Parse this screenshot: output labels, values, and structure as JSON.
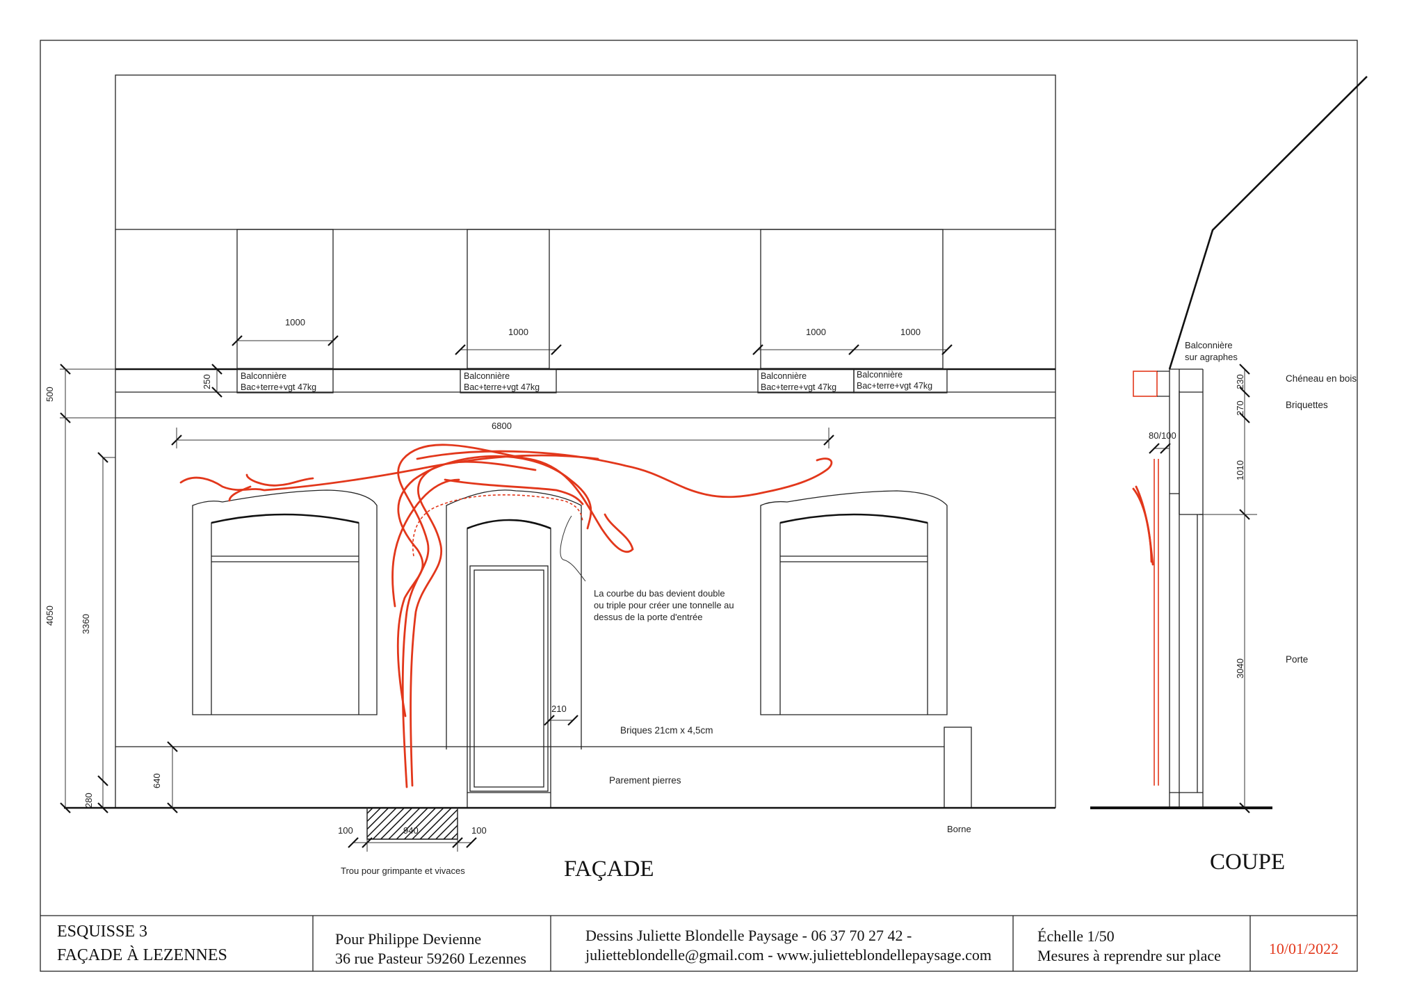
{
  "colors": {
    "line": "#222222",
    "plant": "#e2371b",
    "date": "#e2371b"
  },
  "facade": {
    "balcony_widths": [
      "1000",
      "1000",
      "1000",
      "1000"
    ],
    "balcony_label_line1": [
      "Balconnière",
      "Balconnière",
      "Balconnière",
      "Balconnière"
    ],
    "balcony_label_line2": [
      "Bac+terre+vgt 47kg",
      "Bac+terre+vgt 47kg",
      "Bac+terre+vgt 47kg",
      "Bac+terre+vgt 47kg"
    ],
    "dim_250": "250",
    "dim_500": "500",
    "dim_6800": "6800",
    "dim_4050": "4050",
    "dim_3360": "3360",
    "dim_640": "640",
    "dim_280": "280",
    "dim_210": "210",
    "dim_100_left": "100",
    "dim_940": "940",
    "dim_100_right": "100",
    "note_line1": "La courbe du bas devient double",
    "note_line2": "ou triple pour créer une tonnelle au",
    "note_line3": "dessus de la porte d'entrée",
    "bricks_label": "Briques 21cm x 4,5cm",
    "stone_label": "Parement pierres",
    "borne_label": "Borne",
    "hole_label": "Trou pour grimpante et vivaces",
    "title": "FAÇADE"
  },
  "coupe": {
    "balcony_line1": "Balconnière",
    "balcony_line2": "sur agraphes",
    "gutter_label": "Chéneau en bois",
    "bricks_label": "Briquettes",
    "door_label": "Porte",
    "dim_230": "230",
    "dim_270": "270",
    "dim_80_100": "80/100",
    "dim_1010": "1010",
    "dim_3040": "3040",
    "title": "COUPE"
  },
  "titleblock": {
    "sketch_line1": "ESQUISSE 3",
    "sketch_line2": "FAÇADE À LEZENNES",
    "client_line1": "Pour Philippe Devienne",
    "client_line2": "36 rue Pasteur 59260 Lezennes",
    "author_line1": "Dessins Juliette Blondelle Paysage -  06 37 70 27 42 -",
    "author_line2": "julietteblondelle@gmail.com - www.julietteblondellepaysage.com",
    "scale_line1": "Échelle 1/50",
    "scale_line2": "Mesures à reprendre sur place",
    "date": "10/01/2022"
  }
}
